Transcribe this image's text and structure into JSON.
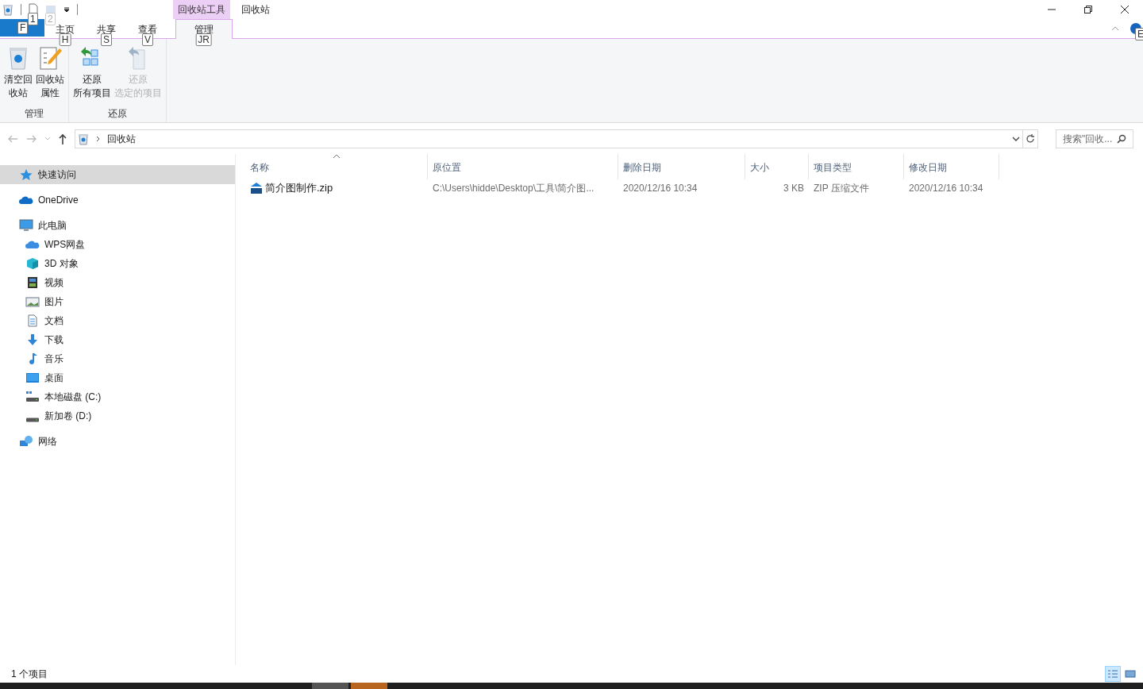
{
  "quick_access_toolbar": {
    "keytips": [
      "1",
      "2"
    ]
  },
  "title_bar": {
    "context_tab_group": "回收站工具",
    "title": "回收站"
  },
  "ribbon": {
    "file_tab": {
      "keytip": "F"
    },
    "tabs": [
      {
        "label": "主页",
        "keytip": "H",
        "selected": false
      },
      {
        "label": "共享",
        "keytip": "S",
        "selected": false
      },
      {
        "label": "查看",
        "keytip": "V",
        "selected": false
      },
      {
        "label": "管理",
        "keytip": "JR",
        "selected": true
      }
    ],
    "help_keytip": "E",
    "groups": [
      {
        "label": "管理",
        "buttons": [
          {
            "lines": [
              "清空回",
              "收站"
            ],
            "disabled": false
          },
          {
            "lines": [
              "回收站",
              "属性"
            ],
            "disabled": false
          }
        ]
      },
      {
        "label": "还原",
        "buttons": [
          {
            "lines": [
              "还原",
              "所有项目"
            ],
            "disabled": false
          },
          {
            "lines": [
              "还原",
              "选定的项目"
            ],
            "disabled": true
          }
        ]
      }
    ]
  },
  "address_bar": {
    "path": "回收站",
    "search_placeholder": "搜索\"回收..."
  },
  "navigation_pane": [
    {
      "label": "快速访问",
      "selected": true
    },
    {
      "label": "OneDrive",
      "selected": false
    },
    {
      "label": "此电脑",
      "selected": false,
      "children": [
        {
          "label": "WPS网盘",
          "selected": false
        },
        {
          "label": "3D 对象",
          "selected": false
        },
        {
          "label": "视频",
          "selected": false
        },
        {
          "label": "图片",
          "selected": false
        },
        {
          "label": "文档",
          "selected": false
        },
        {
          "label": "下载",
          "selected": false
        },
        {
          "label": "音乐",
          "selected": false
        },
        {
          "label": "桌面",
          "selected": false
        },
        {
          "label": "本地磁盘 (C:)",
          "selected": false
        },
        {
          "label": "新加卷 (D:)",
          "selected": false
        }
      ]
    },
    {
      "label": "网络",
      "selected": false
    }
  ],
  "table": {
    "columns": [
      "名称",
      "原位置",
      "删除日期",
      "大小",
      "项目类型",
      "修改日期"
    ],
    "rows": [
      [
        "简介图制作.zip",
        "C:\\Users\\hidde\\Desktop\\工具\\简介图...",
        "2020/12/16 10:34",
        "3 KB",
        "ZIP 压缩文件",
        "2020/12/16 10:34"
      ]
    ]
  },
  "status_bar": {
    "item_count": "1 个项目",
    "views": [
      {
        "selected": true
      },
      {
        "selected": false
      }
    ]
  }
}
